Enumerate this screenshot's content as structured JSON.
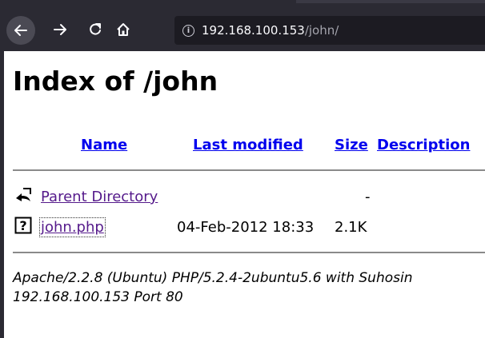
{
  "browser": {
    "url_host": "192.168.100.153",
    "url_path": "/john/",
    "buttons": {
      "back": "back-icon",
      "forward": "forward-icon",
      "reload": "reload-icon",
      "home": "home-icon"
    }
  },
  "page": {
    "title": "Index of /john",
    "columns": {
      "name": "Name",
      "last_modified": "Last modified",
      "size": "Size",
      "description": "Description"
    },
    "rows": [
      {
        "icon": "back-arrow-icon",
        "name": "Parent Directory",
        "last_modified": "",
        "size": "-",
        "description": ""
      },
      {
        "icon": "unknown-file-icon",
        "name": "john.php",
        "last_modified": "04-Feb-2012 18:33",
        "size": "2.1K",
        "description": ""
      }
    ],
    "address_line1": "Apache/2.2.8 (Ubuntu) PHP/5.2.4-2ubuntu5.6 with Suhosin",
    "address_line2": "192.168.100.153 Port 80"
  },
  "colors": {
    "link": "#0000ee",
    "visited": "#551a8b",
    "toolbar": "#2b2a33"
  }
}
